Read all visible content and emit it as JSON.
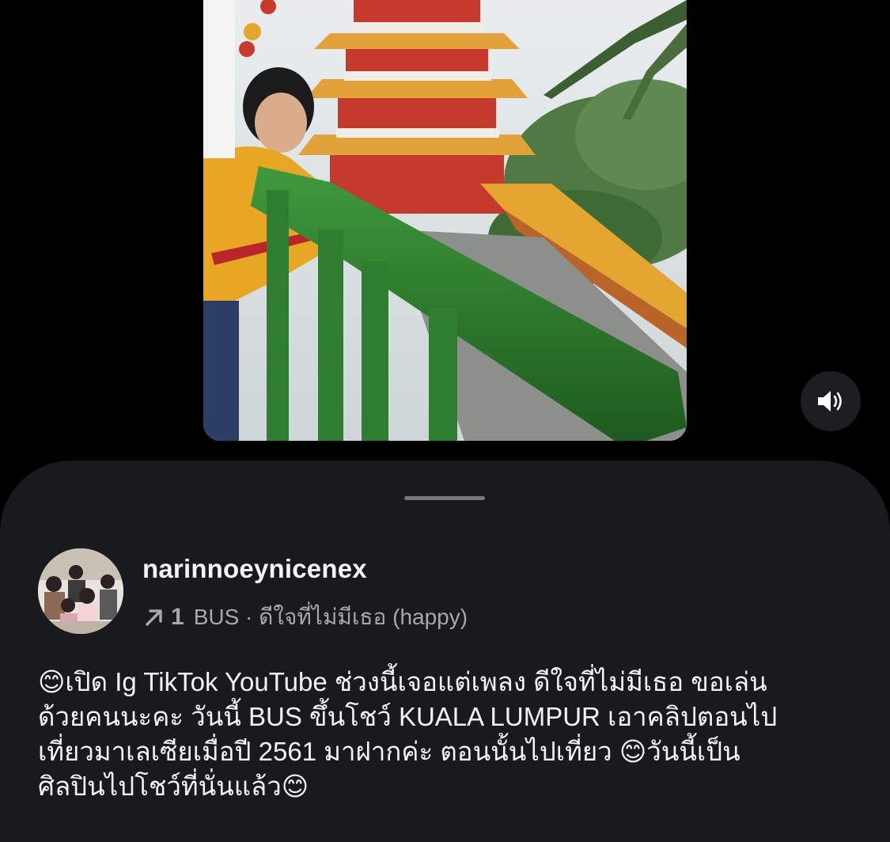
{
  "video": {
    "sound_state": "unmuted",
    "sound_icon": "speaker-icon"
  },
  "post": {
    "username": "narinnoeynicenex",
    "repost_count": "1",
    "music": "BUS · ดีใจที่ไม่มีเธอ (happy)",
    "caption_lines": [
      "😊เปิด Ig TikTok  YouTube ช่วงนี้เจอแต่เพลง ดีใจที่ไม่มีเธอ ขอเล่น",
      "ด้วยคนนะคะ วันนี้ BUS ขึ้นโชว์ KUALA LUMPUR เอาคลิปตอนไป",
      "เที่ยวมาเลเซียเมื่อปี 2561 มาฝากค่ะ ตอนนั้นไปเที่ยว  😊วันนี้เป็น",
      "ศิลปินไปโชว์ที่นั่นแล้ว😊"
    ]
  },
  "colors": {
    "background": "#000000",
    "sheet": "#181a1d",
    "text_primary": "#f2f3f5",
    "text_secondary": "#a6a8ac"
  }
}
